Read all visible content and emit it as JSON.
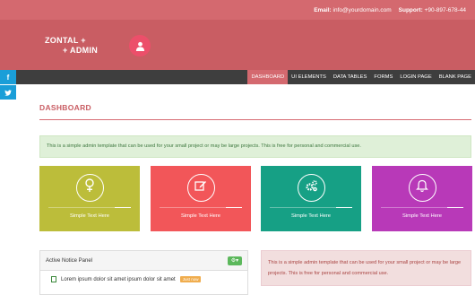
{
  "topbar": {
    "email_label": "Email:",
    "email_value": "info@yourdomain.com",
    "support_label": "Support:",
    "support_value": "+90-897-678-44"
  },
  "logo": {
    "line1": "ZONTAL +",
    "line2": "+ ADMIN"
  },
  "nav": {
    "items": [
      "DASHBOARD",
      "UI ELEMENTS",
      "DATA TABLES",
      "FORMS",
      "LOGIN PAGE",
      "BLANK PAGE"
    ],
    "active_index": 0
  },
  "social": {
    "facebook": "f",
    "twitter": "t"
  },
  "page": {
    "title": "DASHBOARD"
  },
  "alert_green": "This is a simple admin template that can be used for your small project or may be large projects. This is free for personal and commercial use.",
  "cards": [
    {
      "text": "Simple Text Here",
      "color": "#bcbd3a",
      "icon": "female-icon",
      "progress": 0.2
    },
    {
      "text": "Simple Text Here",
      "color": "#f25659",
      "icon": "edit-icon",
      "progress": 0.2
    },
    {
      "text": "Simple Text Here",
      "color": "#16a085",
      "icon": "cogs-icon",
      "progress": 0.2
    },
    {
      "text": "Simple Text Here",
      "color": "#b839b8",
      "icon": "bell-icon",
      "progress": 0.2
    }
  ],
  "panel": {
    "title": "Active Notice Panel",
    "row_text": "Lorem ipsum dolor sit amet ipsum dolor sit amet",
    "badge": "Just now"
  },
  "alert_red": "This is a simple admin template that can be used for your small project or may be large projects. This is free for personal and commercial use."
}
